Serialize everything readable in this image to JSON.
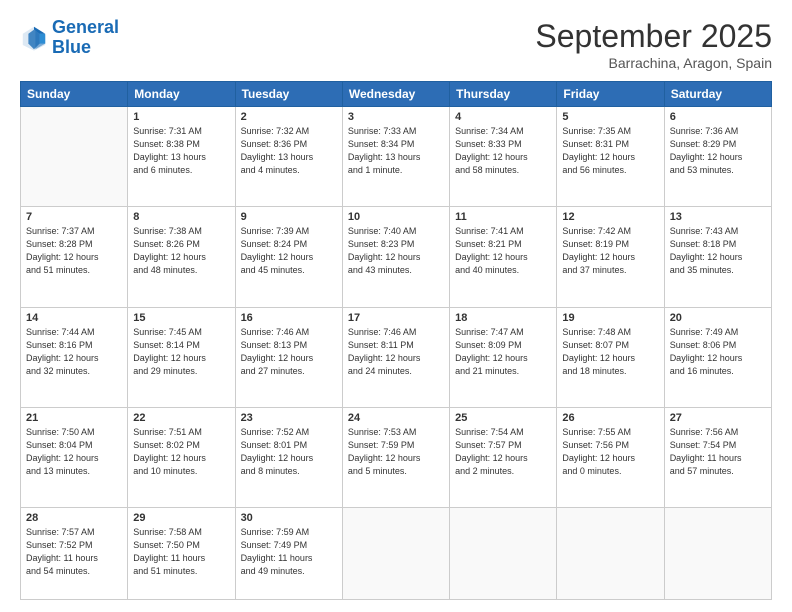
{
  "logo": {
    "line1": "General",
    "line2": "Blue"
  },
  "header": {
    "month": "September 2025",
    "location": "Barrachina, Aragon, Spain"
  },
  "weekdays": [
    "Sunday",
    "Monday",
    "Tuesday",
    "Wednesday",
    "Thursday",
    "Friday",
    "Saturday"
  ],
  "weeks": [
    [
      {
        "day": "",
        "info": ""
      },
      {
        "day": "1",
        "info": "Sunrise: 7:31 AM\nSunset: 8:38 PM\nDaylight: 13 hours\nand 6 minutes."
      },
      {
        "day": "2",
        "info": "Sunrise: 7:32 AM\nSunset: 8:36 PM\nDaylight: 13 hours\nand 4 minutes."
      },
      {
        "day": "3",
        "info": "Sunrise: 7:33 AM\nSunset: 8:34 PM\nDaylight: 13 hours\nand 1 minute."
      },
      {
        "day": "4",
        "info": "Sunrise: 7:34 AM\nSunset: 8:33 PM\nDaylight: 12 hours\nand 58 minutes."
      },
      {
        "day": "5",
        "info": "Sunrise: 7:35 AM\nSunset: 8:31 PM\nDaylight: 12 hours\nand 56 minutes."
      },
      {
        "day": "6",
        "info": "Sunrise: 7:36 AM\nSunset: 8:29 PM\nDaylight: 12 hours\nand 53 minutes."
      }
    ],
    [
      {
        "day": "7",
        "info": "Sunrise: 7:37 AM\nSunset: 8:28 PM\nDaylight: 12 hours\nand 51 minutes."
      },
      {
        "day": "8",
        "info": "Sunrise: 7:38 AM\nSunset: 8:26 PM\nDaylight: 12 hours\nand 48 minutes."
      },
      {
        "day": "9",
        "info": "Sunrise: 7:39 AM\nSunset: 8:24 PM\nDaylight: 12 hours\nand 45 minutes."
      },
      {
        "day": "10",
        "info": "Sunrise: 7:40 AM\nSunset: 8:23 PM\nDaylight: 12 hours\nand 43 minutes."
      },
      {
        "day": "11",
        "info": "Sunrise: 7:41 AM\nSunset: 8:21 PM\nDaylight: 12 hours\nand 40 minutes."
      },
      {
        "day": "12",
        "info": "Sunrise: 7:42 AM\nSunset: 8:19 PM\nDaylight: 12 hours\nand 37 minutes."
      },
      {
        "day": "13",
        "info": "Sunrise: 7:43 AM\nSunset: 8:18 PM\nDaylight: 12 hours\nand 35 minutes."
      }
    ],
    [
      {
        "day": "14",
        "info": "Sunrise: 7:44 AM\nSunset: 8:16 PM\nDaylight: 12 hours\nand 32 minutes."
      },
      {
        "day": "15",
        "info": "Sunrise: 7:45 AM\nSunset: 8:14 PM\nDaylight: 12 hours\nand 29 minutes."
      },
      {
        "day": "16",
        "info": "Sunrise: 7:46 AM\nSunset: 8:13 PM\nDaylight: 12 hours\nand 27 minutes."
      },
      {
        "day": "17",
        "info": "Sunrise: 7:46 AM\nSunset: 8:11 PM\nDaylight: 12 hours\nand 24 minutes."
      },
      {
        "day": "18",
        "info": "Sunrise: 7:47 AM\nSunset: 8:09 PM\nDaylight: 12 hours\nand 21 minutes."
      },
      {
        "day": "19",
        "info": "Sunrise: 7:48 AM\nSunset: 8:07 PM\nDaylight: 12 hours\nand 18 minutes."
      },
      {
        "day": "20",
        "info": "Sunrise: 7:49 AM\nSunset: 8:06 PM\nDaylight: 12 hours\nand 16 minutes."
      }
    ],
    [
      {
        "day": "21",
        "info": "Sunrise: 7:50 AM\nSunset: 8:04 PM\nDaylight: 12 hours\nand 13 minutes."
      },
      {
        "day": "22",
        "info": "Sunrise: 7:51 AM\nSunset: 8:02 PM\nDaylight: 12 hours\nand 10 minutes."
      },
      {
        "day": "23",
        "info": "Sunrise: 7:52 AM\nSunset: 8:01 PM\nDaylight: 12 hours\nand 8 minutes."
      },
      {
        "day": "24",
        "info": "Sunrise: 7:53 AM\nSunset: 7:59 PM\nDaylight: 12 hours\nand 5 minutes."
      },
      {
        "day": "25",
        "info": "Sunrise: 7:54 AM\nSunset: 7:57 PM\nDaylight: 12 hours\nand 2 minutes."
      },
      {
        "day": "26",
        "info": "Sunrise: 7:55 AM\nSunset: 7:56 PM\nDaylight: 12 hours\nand 0 minutes."
      },
      {
        "day": "27",
        "info": "Sunrise: 7:56 AM\nSunset: 7:54 PM\nDaylight: 11 hours\nand 57 minutes."
      }
    ],
    [
      {
        "day": "28",
        "info": "Sunrise: 7:57 AM\nSunset: 7:52 PM\nDaylight: 11 hours\nand 54 minutes."
      },
      {
        "day": "29",
        "info": "Sunrise: 7:58 AM\nSunset: 7:50 PM\nDaylight: 11 hours\nand 51 minutes."
      },
      {
        "day": "30",
        "info": "Sunrise: 7:59 AM\nSunset: 7:49 PM\nDaylight: 11 hours\nand 49 minutes."
      },
      {
        "day": "",
        "info": ""
      },
      {
        "day": "",
        "info": ""
      },
      {
        "day": "",
        "info": ""
      },
      {
        "day": "",
        "info": ""
      }
    ]
  ]
}
